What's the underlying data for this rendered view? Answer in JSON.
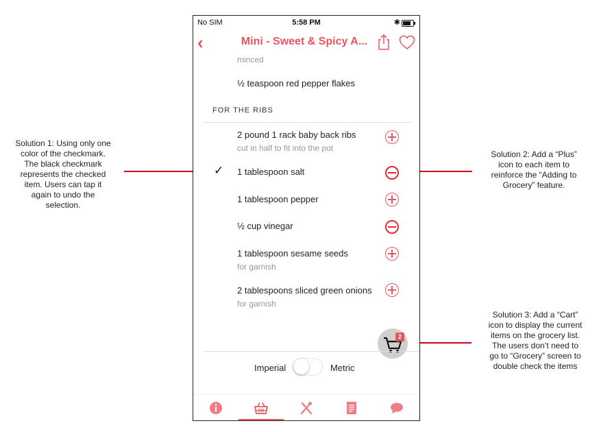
{
  "annotations": {
    "solution1": "Solution 1: Using only one\ncolor of the checkmark.\nThe black checkmark\nrepresents the checked\nitem. Users can tap it\nagain to undo the\nselection.",
    "solution2": "Solution 2: Add a “Plus”\nicon to each item to\nreinforce the “Adding to\nGrocery” feature.",
    "solution3": "Solution 3: Add a “Cart”\nicon to display the current\nitems on the grocery list.\nThe users don’t need to\ngo to “Grocery” screen to\ndouble check the items"
  },
  "status_bar": {
    "carrier": "No SIM",
    "time": "5:58 PM",
    "bluetooth": "✱"
  },
  "nav": {
    "back": "‹",
    "title": "Mini - Sweet & Spicy A..."
  },
  "content": {
    "partial_text": "minced",
    "pepper_flakes": "½ teaspoon red pepper flakes",
    "section_title": "FOR THE RIBS",
    "items": [
      {
        "name": "2 pound 1 rack baby back ribs",
        "note": "cut in half to fit into the pot",
        "state": "add"
      },
      {
        "name": "1 tablespoon salt",
        "note": "",
        "state": "checked"
      },
      {
        "name": "1 tablespoon pepper",
        "note": "",
        "state": "add"
      },
      {
        "name": "½ cup vinegar",
        "note": "",
        "state": "checked"
      },
      {
        "name": "1 tablespoon sesame seeds",
        "note": "for garnish",
        "state": "add"
      },
      {
        "name": "2 tablespoons sliced green onions",
        "note": "for garnish",
        "state": "add"
      }
    ],
    "checkmark": "✓"
  },
  "cart": {
    "count": "2"
  },
  "units": {
    "left": "Imperial",
    "right": "Metric",
    "metric_enabled": false
  },
  "tabs": [
    "info",
    "grocery",
    "utensils",
    "directions",
    "comments"
  ],
  "selected_tab": "grocery",
  "colors": {
    "accent": "#e8555f",
    "annotation": "#d0021b"
  }
}
